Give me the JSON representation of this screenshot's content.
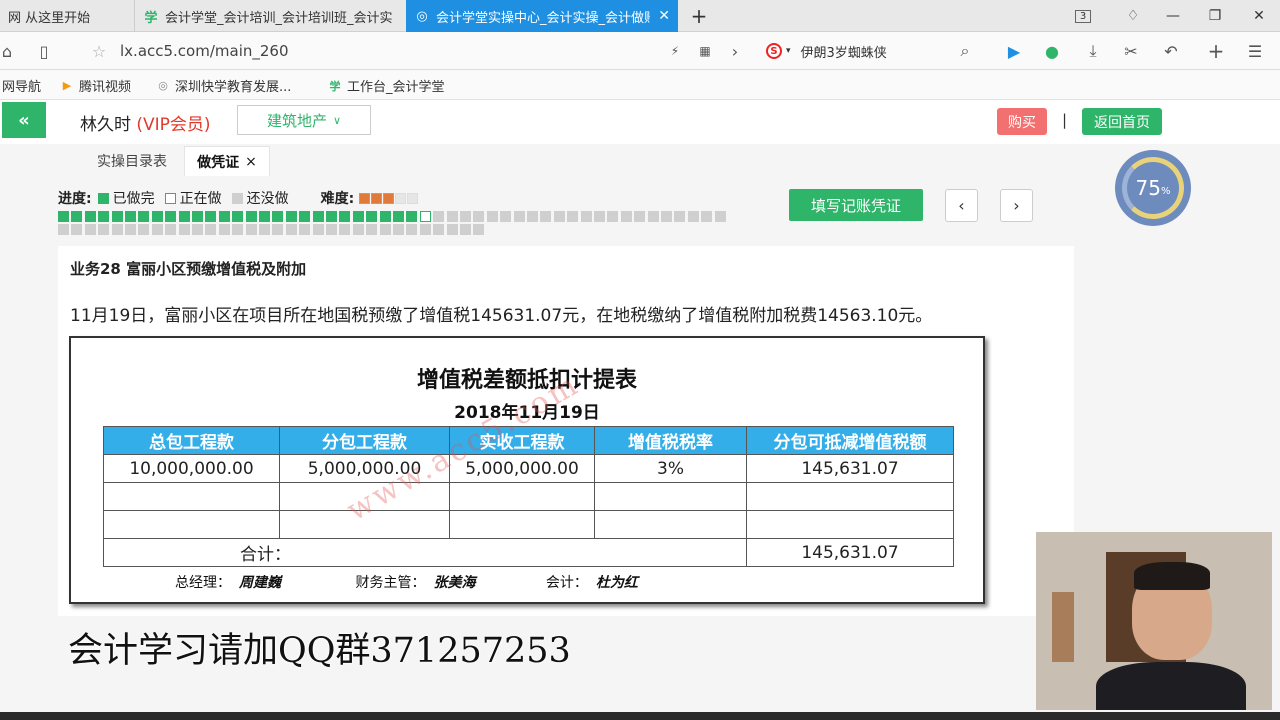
{
  "browser": {
    "tabs": [
      {
        "label": "网 从这里开始",
        "icon": "home-icon",
        "active": false
      },
      {
        "label": "会计学堂_会计培训_会计培训班_会计实",
        "icon": "xue-logo-icon",
        "active": false
      },
      {
        "label": "会计学堂实操中心_会计实操_会计做账",
        "icon": "globe-icon",
        "active": true
      }
    ],
    "tab_count": "3",
    "url": "lx.acc5.com/main_260",
    "search_text": "伊朗3岁蜘蛛侠"
  },
  "bookmarks": [
    {
      "label": "网导航",
      "icon": ""
    },
    {
      "label": "腾讯视频",
      "icon": "play-icon"
    },
    {
      "label": "深圳快学教育发展...",
      "icon": "globe-icon"
    },
    {
      "label": "工作台_会计学堂",
      "icon": "xue-logo-icon"
    }
  ],
  "header": {
    "username": "林久时",
    "vip": " (VIP会员)",
    "category": "建筑地产",
    "buy_label": "购买",
    "separator": "|",
    "home_label": "返回首页"
  },
  "page_tabs": [
    {
      "label": "实操目录表",
      "active": false
    },
    {
      "label": "做凭证",
      "active": true,
      "close": "×"
    }
  ],
  "progress": {
    "label": "进度:",
    "legend_done": "已做完",
    "legend_doing": "正在做",
    "legend_todo": "还没做",
    "difficulty_label": "难度:",
    "difficulty_stars": 3,
    "difficulty_max": 5,
    "total_items": 82,
    "done_items": 27,
    "current_item": 28,
    "colors": {
      "done": "#2fb56a",
      "doing": "#ffffff",
      "todo": "#cfcfcf",
      "star": "#e07a3a"
    }
  },
  "actions": {
    "write_voucher": "填写记账凭证",
    "prev": "‹",
    "next": "›"
  },
  "gauge": {
    "value": "75",
    "unit": "%"
  },
  "business": {
    "title": "业务28 富丽小区预缴增值税及附加",
    "description": "11月19日，富丽小区在项目所在地国税预缴了增值税145631.07元，在地税缴纳了增值税附加税费14563.10元。"
  },
  "voucher": {
    "title": "增值税差额抵扣计提表",
    "date": "2018年11月19日",
    "columns": [
      "总包工程款",
      "分包工程款",
      "实收工程款",
      "增值税税率",
      "分包可抵减增值税额"
    ],
    "rows": [
      [
        "10,000,000.00",
        "5,000,000.00",
        "5,000,000.00",
        "3%",
        "145,631.07"
      ],
      [
        "",
        "",
        "",
        "",
        ""
      ],
      [
        "",
        "",
        "",
        "",
        ""
      ]
    ],
    "total_label": "合计：",
    "total_value": "145,631.07",
    "signatures": [
      {
        "role": "总经理：",
        "name": "周建巍"
      },
      {
        "role": "财务主管：",
        "name": "张美海"
      },
      {
        "role": "会计：",
        "name": "杜为红"
      }
    ],
    "watermark": "www.acc5.com"
  },
  "overlay": {
    "qq_text": "会计学习请加QQ群371257253"
  }
}
